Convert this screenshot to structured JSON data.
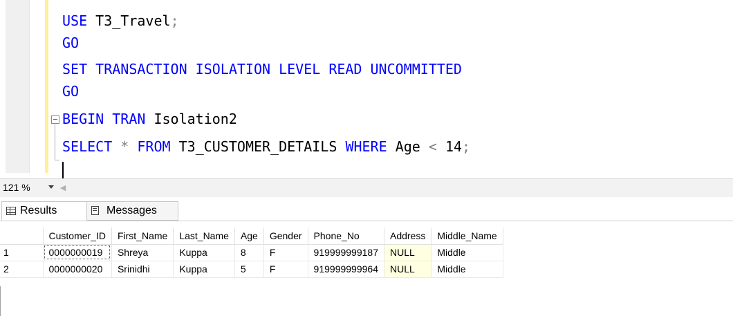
{
  "editor": {
    "lines": [
      [
        {
          "t": "USE ",
          "c": "kw"
        },
        {
          "t": "T3_Travel",
          "c": "plain"
        },
        {
          "t": ";",
          "c": "op"
        }
      ],
      [
        {
          "t": "GO",
          "c": "kw"
        }
      ],
      [
        {
          "t": "SET TRANSACTION ISOLATION LEVEL READ UNCOMMITTED",
          "c": "kw"
        }
      ],
      [
        {
          "t": "GO",
          "c": "kw"
        }
      ],
      [
        {
          "t": "BEGIN TRAN ",
          "c": "kw"
        },
        {
          "t": "Isolation2",
          "c": "plain"
        }
      ],
      [
        {
          "t": "SELECT ",
          "c": "kw"
        },
        {
          "t": "* ",
          "c": "op"
        },
        {
          "t": "FROM ",
          "c": "kw"
        },
        {
          "t": "T3_CUSTOMER_DETAILS ",
          "c": "plain"
        },
        {
          "t": "WHERE ",
          "c": "kw"
        },
        {
          "t": "Age ",
          "c": "plain"
        },
        {
          "t": "< ",
          "c": "op"
        },
        {
          "t": "14",
          "c": "plain"
        },
        {
          "t": ";",
          "c": "op"
        }
      ]
    ]
  },
  "status": {
    "zoom": "121 %"
  },
  "results": {
    "tabs": [
      {
        "label": "Results"
      },
      {
        "label": "Messages"
      }
    ],
    "columns": [
      "Customer_ID",
      "First_Name",
      "Last_Name",
      "Age",
      "Gender",
      "Phone_No",
      "Address",
      "Middle_Name"
    ],
    "rows": [
      {
        "num": "1",
        "cells": [
          "0000000019",
          "Shreya",
          "Kuppa",
          "8",
          "F",
          "919999999187",
          "NULL",
          "Middle"
        ]
      },
      {
        "num": "2",
        "cells": [
          "0000000020",
          "Srinidhi",
          "Kuppa",
          "5",
          "F",
          "919999999964",
          "NULL",
          "Middle"
        ]
      }
    ]
  },
  "colors": {
    "keyword": "#0000ff",
    "operator": "#808080",
    "null_highlight": "#ffffe1",
    "change_bar": "#ffef99"
  }
}
